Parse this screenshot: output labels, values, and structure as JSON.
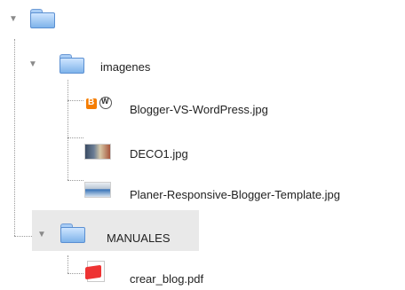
{
  "tree": {
    "root": {
      "label": ""
    },
    "imagenes": {
      "label": "imagenes",
      "files": [
        {
          "label": "Blogger-VS-WordPress.jpg",
          "icon": "blogger-wordpress-icon"
        },
        {
          "label": "DECO1.jpg",
          "icon": "image-thumbnail-icon"
        },
        {
          "label": "Planer-Responsive-Blogger-Template.jpg",
          "icon": "image-thumbnail-icon"
        }
      ]
    },
    "manuales": {
      "label": "MANUALES",
      "files": [
        {
          "label": "crear_blog.pdf",
          "icon": "pdf-icon"
        }
      ]
    }
  }
}
